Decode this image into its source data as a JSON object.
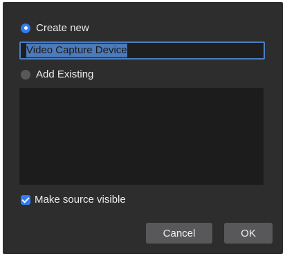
{
  "dialog": {
    "create_new_label": "Create new",
    "create_new_selected": true,
    "source_name_value": "Video Capture Device",
    "add_existing_label": "Add Existing",
    "add_existing_selected": false,
    "existing_sources": [],
    "make_visible_label": "Make source visible",
    "make_visible_checked": true,
    "cancel_label": "Cancel",
    "ok_label": "OK"
  },
  "colors": {
    "dialog_bg": "#2d2d2e",
    "accent": "#2f7df6",
    "selection": "#4d7ab8",
    "button_bg": "#58585a",
    "list_bg": "#1c1c1c"
  }
}
